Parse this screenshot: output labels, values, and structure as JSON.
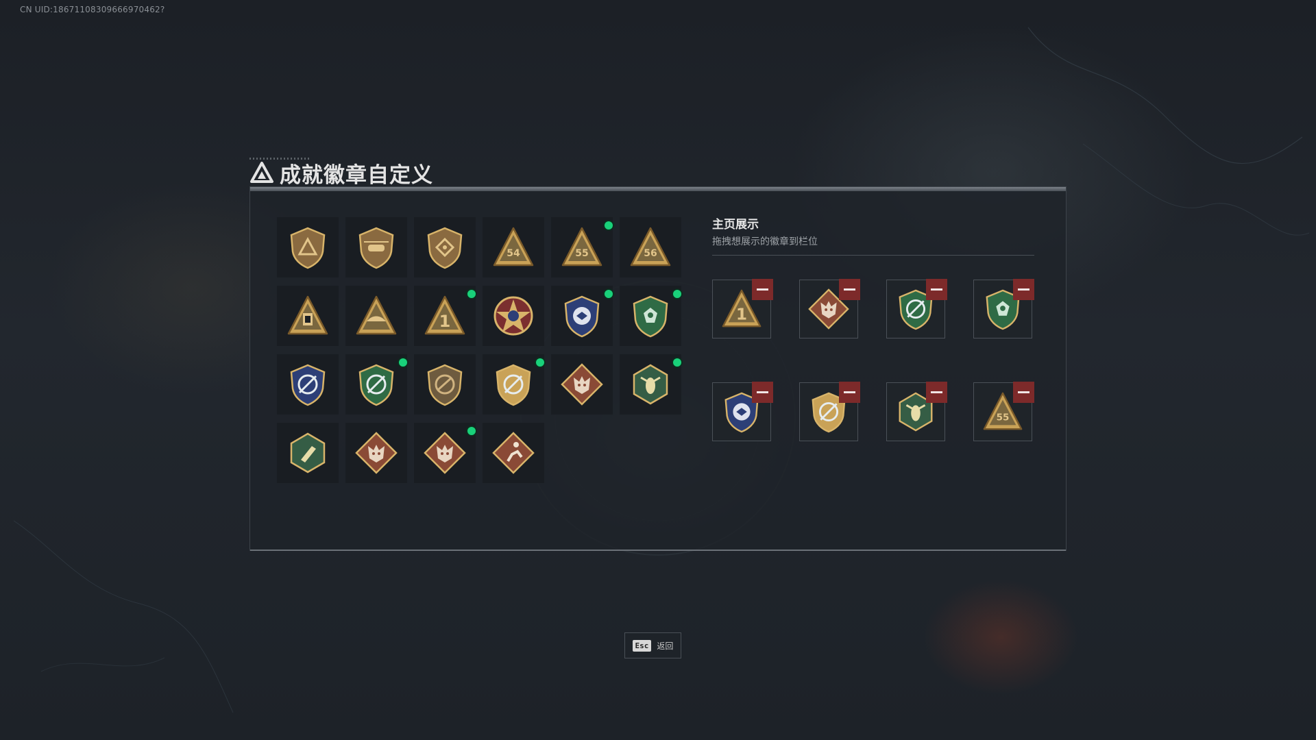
{
  "user": {
    "uid_text": "CN UID:18671108309666970462?"
  },
  "page": {
    "title": "成就徽章自定义"
  },
  "badges": [
    {
      "name": "bronze-triangle-shield-badge",
      "shape": "shield",
      "color": "#8a6a40",
      "inner": "triangle",
      "new": false
    },
    {
      "name": "bronze-helicopter-shield-badge",
      "shape": "shield",
      "color": "#8a6a40",
      "inner": "heli",
      "new": false
    },
    {
      "name": "bronze-diamond-shield-badge",
      "shape": "shield",
      "color": "#8a6a40",
      "inner": "diamond",
      "new": false
    },
    {
      "name": "gold-triangle-54-badge",
      "shape": "triangle",
      "color": "#c9a257",
      "inner": "54",
      "new": false
    },
    {
      "name": "gold-triangle-55-badge",
      "shape": "triangle",
      "color": "#c9a257",
      "inner": "55",
      "new": true
    },
    {
      "name": "gold-triangle-56-badge",
      "shape": "triangle",
      "color": "#c9a257",
      "inner": "56",
      "new": false
    },
    {
      "name": "gold-triangle-lantern-badge",
      "shape": "triangle",
      "color": "#c9a257",
      "inner": "lantern",
      "new": false
    },
    {
      "name": "gold-triangle-bird-badge",
      "shape": "triangle",
      "color": "#c9a257",
      "inner": "bird",
      "new": false
    },
    {
      "name": "gold-triangle-number-one-badge",
      "shape": "triangle",
      "color": "#c9a257",
      "inner": "1",
      "new": true
    },
    {
      "name": "gold-star-medal-badge",
      "shape": "star",
      "color": "#c9a257",
      "inner": "star",
      "new": false
    },
    {
      "name": "blue-police-shield-badge",
      "shape": "shield",
      "color": "#2d3f77",
      "inner": "eagle",
      "new": true
    },
    {
      "name": "green-beret-shield-badge",
      "shape": "shield",
      "color": "#2f6b45",
      "inner": "skull",
      "new": true
    },
    {
      "name": "blue-crosshair-shield-badge",
      "shape": "shield",
      "color": "#2d3f77",
      "inner": "cross",
      "new": false
    },
    {
      "name": "green-crosshair-shield-badge",
      "shape": "shield",
      "color": "#2f6b45",
      "inner": "cross",
      "new": true
    },
    {
      "name": "bronze-rifle-shield-badge",
      "shape": "shield",
      "color": "#6e5b3f",
      "inner": "rifle",
      "new": false
    },
    {
      "name": "gold-target-laurel-badge",
      "shape": "shield",
      "color": "#c9a257",
      "inner": "cross",
      "new": true
    },
    {
      "name": "red-wolf-diamond-badge",
      "shape": "diamond",
      "color": "#8a4a36",
      "inner": "wolf",
      "new": false
    },
    {
      "name": "green-wasp-hexagon-badge",
      "shape": "hexagon",
      "color": "#355d45",
      "inner": "wasp",
      "new": true
    },
    {
      "name": "green-rocket-hexagon-badge",
      "shape": "hexagon",
      "color": "#355d45",
      "inner": "rocket",
      "new": false
    },
    {
      "name": "red-dragon-diamond-badge",
      "shape": "diamond",
      "color": "#8a4a36",
      "inner": "dragon",
      "new": false
    },
    {
      "name": "red-dragon-gold-diamond-badge",
      "shape": "diamond",
      "color": "#8a4a36",
      "inner": "dragon",
      "new": true
    },
    {
      "name": "red-runner-diamond-badge",
      "shape": "diamond",
      "color": "#8a4a36",
      "inner": "runner",
      "new": false
    }
  ],
  "display": {
    "title": "主页展示",
    "subtitle": "拖拽想展示的徽章到栏位",
    "slots": [
      {
        "name": "slot-number-one-badge",
        "shape": "triangle",
        "color": "#c9a257",
        "inner": "1"
      },
      {
        "name": "slot-dragon-badge",
        "shape": "diamond",
        "color": "#8a4a36",
        "inner": "dragon"
      },
      {
        "name": "slot-green-crosshair-badge",
        "shape": "shield",
        "color": "#2f6b45",
        "inner": "cross"
      },
      {
        "name": "slot-green-beret-badge",
        "shape": "shield",
        "color": "#2f6b45",
        "inner": "skull"
      },
      {
        "name": "slot-blue-police-badge",
        "shape": "shield",
        "color": "#2d3f77",
        "inner": "eagle"
      },
      {
        "name": "slot-gold-target-badge",
        "shape": "shield",
        "color": "#c9a257",
        "inner": "cross"
      },
      {
        "name": "slot-wasp-badge",
        "shape": "hexagon",
        "color": "#355d45",
        "inner": "wasp"
      },
      {
        "name": "slot-55-badge",
        "shape": "triangle",
        "color": "#c9a257",
        "inner": "55"
      }
    ]
  },
  "footer": {
    "esc_key": "Esc",
    "back_label": "返回"
  }
}
